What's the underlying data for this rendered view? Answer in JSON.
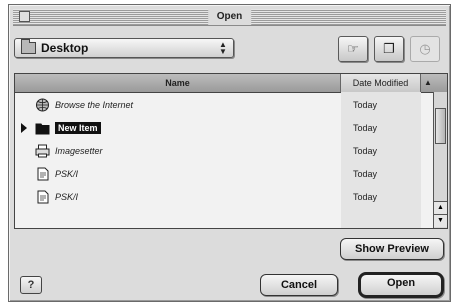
{
  "window": {
    "title": "Open"
  },
  "location_popup": {
    "selected": "Desktop"
  },
  "toolbar": {
    "shortcuts_icon": "shortcuts-icon",
    "favorites_icon": "favorites-icon",
    "recent_icon": "recent-icon"
  },
  "file_list": {
    "columns": {
      "name": "Name",
      "date": "Date Modified"
    },
    "rows": [
      {
        "name": "Browse the Internet",
        "date": "Today",
        "icon": "globe-icon",
        "folder": false,
        "selected": false
      },
      {
        "name": "New Item",
        "date": "Today",
        "icon": "folder-icon",
        "folder": true,
        "selected": true
      },
      {
        "name": "Imagesetter",
        "date": "Today",
        "icon": "printer-icon",
        "folder": false,
        "selected": false
      },
      {
        "name": "PSK/I",
        "date": "Today",
        "icon": "document-icon",
        "folder": false,
        "selected": false
      },
      {
        "name": "PSK/I",
        "date": "Today",
        "icon": "document-icon",
        "folder": false,
        "selected": false
      }
    ]
  },
  "buttons": {
    "show_preview": "Show Preview",
    "cancel": "Cancel",
    "open": "Open",
    "help": "?"
  }
}
